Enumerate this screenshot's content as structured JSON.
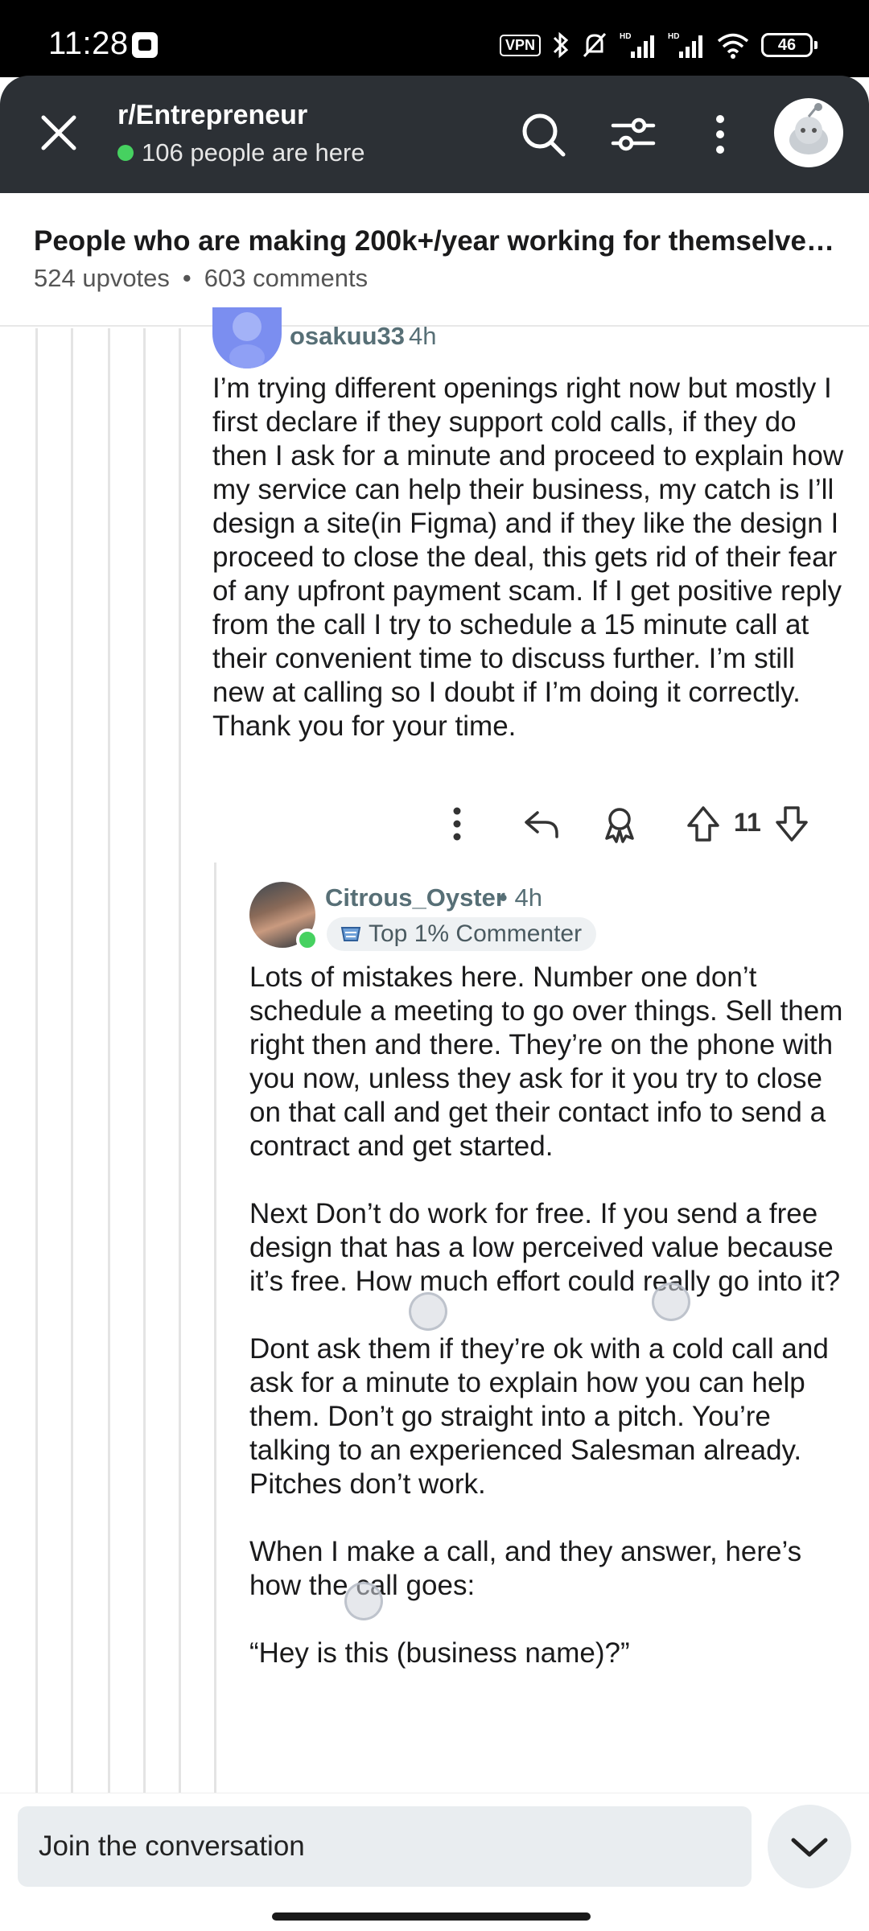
{
  "status_bar": {
    "time": "11:28",
    "vpn": "VPN",
    "battery": "46"
  },
  "header": {
    "subreddit": "r/Entrepreneur",
    "online_text": "106 people are here"
  },
  "post": {
    "title": "People who are making 200k+/year working for themselves,...",
    "upvotes": "524 upvotes",
    "separator": "•",
    "comments": "603 comments"
  },
  "comment1": {
    "username": "osakuu33",
    "time": "4h",
    "body": "I’m trying different openings right now but mostly I first declare if they support cold calls, if they do then I ask for a minute and proceed to explain how my service can help their business, my catch is I’ll design a site(in Figma) and if they like the design I proceed to close the deal, this gets rid of their fear of any upfront payment scam. If I get positive reply from the call I try to schedule a 15 minute call at their convenient time to discuss further. I’m still new at calling so I doubt if I’m doing it correctly. Thank you for your time.",
    "vote_count": "11"
  },
  "comment2": {
    "username": "Citrous_Oyster",
    "time": "• 4h",
    "badge": "Top 1% Commenter",
    "paragraphs": [
      "Lots of mistakes here. Number one don’t schedule a meeting to go over things. Sell them right then and there. They’re on the phone with you now, unless they ask for it you try to close on that call and get their contact info to send a contract and get started.",
      "Next Don’t do work for free. If you send a free design that has a low perceived value because it’s free. How much effort could really go into it?",
      "Dont ask them if they’re ok with a cold call and ask for a minute to explain how you can help them. Don’t go straight into a pitch. You’re talking to an experienced Salesman already. Pitches don’t work.",
      "When I make a call, and they answer, here’s how the call goes:",
      "“Hey is this (business name)?”"
    ]
  },
  "bottom": {
    "join_placeholder": "Join the conversation"
  }
}
